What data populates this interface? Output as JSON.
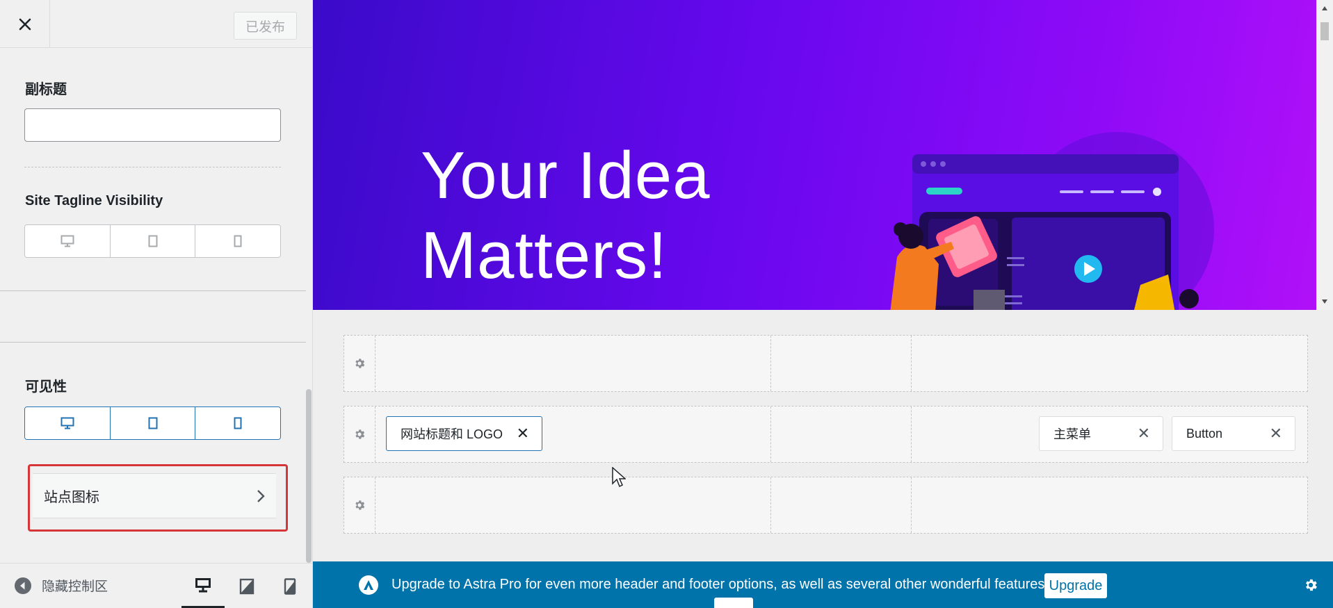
{
  "sidebar": {
    "header": {
      "published_label": "已发布"
    },
    "subtitle": {
      "label": "副标题",
      "value": ""
    },
    "tagline_visibility": {
      "label": "Site Tagline Visibility"
    },
    "visibility": {
      "label": "可见性"
    },
    "site_icon": {
      "label": "站点图标"
    },
    "footer": {
      "hide_controls_label": "隐藏控制区"
    }
  },
  "preview": {
    "hero": {
      "line1": "Your Idea",
      "line2": "Matters!"
    }
  },
  "builder": {
    "rows": [
      {
        "name": "top"
      },
      {
        "name": "primary",
        "items_left": [
          {
            "label": "网站标题和 LOGO"
          }
        ],
        "items_right": [
          {
            "label": "主菜单"
          },
          {
            "label": "Button"
          }
        ]
      },
      {
        "name": "bottom"
      }
    ]
  },
  "upgrade_bar": {
    "message": "Upgrade to Astra Pro for even more header and footer options, as well as several other wonderful features!",
    "button_label": "Upgrade"
  },
  "colors": {
    "accent": "#2271b1",
    "highlight": "#d63638",
    "upgrade_bg": "#0073aa",
    "hero_start": "#3a0ac9",
    "hero_end": "#b010f8"
  },
  "icons": [
    "close-icon",
    "desktop-icon",
    "tablet-icon",
    "mobile-icon",
    "chevron-right-icon",
    "collapse-arrow-icon",
    "gear-icon",
    "astra-logo-icon",
    "mouse-cursor-icon"
  ]
}
